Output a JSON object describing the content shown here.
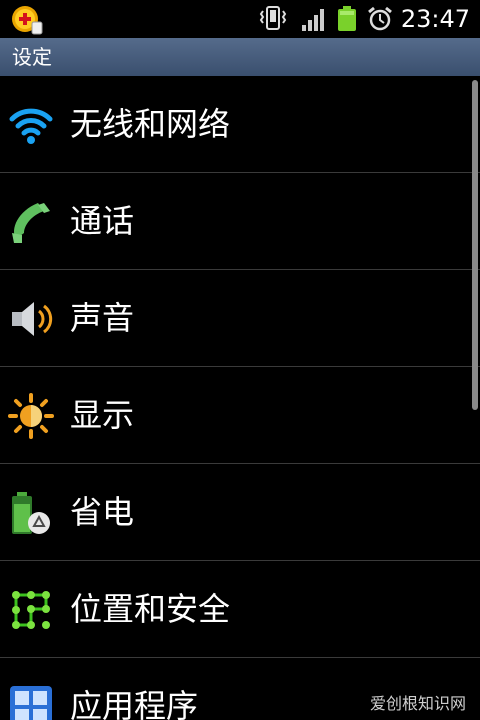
{
  "status_bar": {
    "time": "23:47",
    "icons": [
      "app-notification-icon",
      "vibrate-icon",
      "signal-icon",
      "battery-icon",
      "alarm-icon"
    ],
    "battery_color": "#7ad12b"
  },
  "title_bar": {
    "title": "设定"
  },
  "settings": {
    "items": [
      {
        "label": "无线和网络",
        "icon": "wifi-icon"
      },
      {
        "label": "通话",
        "icon": "phone-icon"
      },
      {
        "label": "声音",
        "icon": "speaker-icon"
      },
      {
        "label": "显示",
        "icon": "brightness-icon"
      },
      {
        "label": "省电",
        "icon": "power-saving-icon"
      },
      {
        "label": "位置和安全",
        "icon": "location-security-icon"
      },
      {
        "label": "应用程序",
        "icon": "applications-icon"
      }
    ]
  },
  "watermark": {
    "text": "爱创根知识网"
  }
}
